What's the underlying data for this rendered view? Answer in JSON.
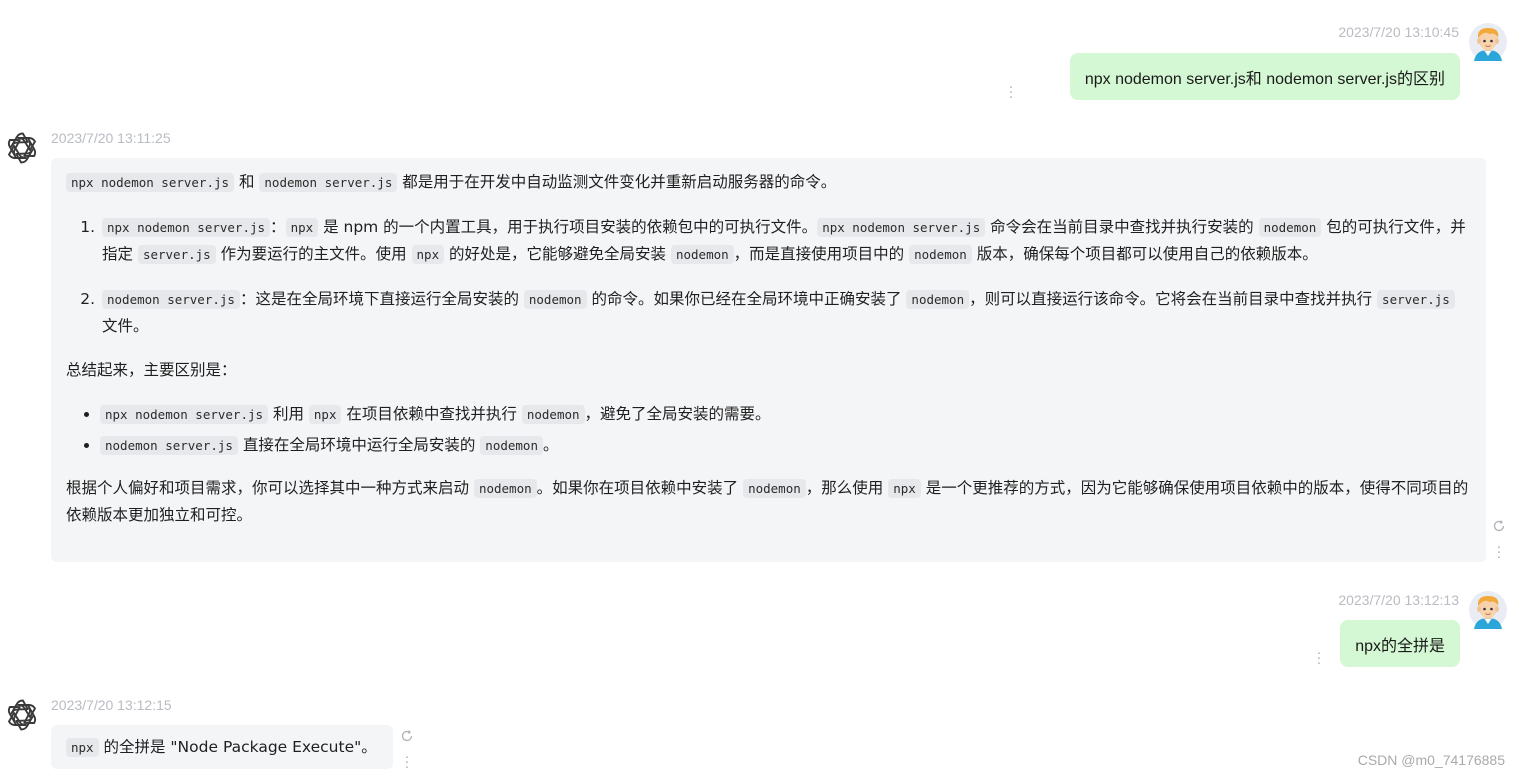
{
  "messages": [
    {
      "role": "user",
      "timestamp": "2023/7/20 13:10:45",
      "text": "npx nodemon server.js和 nodemon server.js的区别"
    },
    {
      "role": "assistant",
      "timestamp": "2023/7/20 13:11:25",
      "intro": {
        "code1": "npx nodemon server.js",
        "t1": " 和 ",
        "code2": "nodemon server.js",
        "t2": " 都是用于在开发中自动监测文件变化并重新启动服务器的命令。"
      },
      "item1": {
        "c1": "npx nodemon server.js",
        "t1": "：",
        "c2": "npx",
        "t2": " 是 npm 的一个内置工具，用于执行项目安装的依赖包中的可执行文件。",
        "c3": "npx nodemon server.js",
        "t3": " 命令会在当前目录中查找并执行安装的 ",
        "c4": "nodemon",
        "t4": " 包的可执行文件，并指定 ",
        "c5": "server.js",
        "t5": " 作为要运行的主文件。使用 ",
        "c6": "npx",
        "t6": " 的好处是，它能够避免全局安装 ",
        "c7": "nodemon",
        "t7": "，而是直接使用项目中的 ",
        "c8": "nodemon",
        "t8": " 版本，确保每个项目都可以使用自己的依赖版本。"
      },
      "item2": {
        "c1": "nodemon server.js",
        "t1": "：这是在全局环境下直接运行全局安装的 ",
        "c2": "nodemon",
        "t2": " 的命令。如果你已经在全局环境中正确安装了 ",
        "c3": "nodemon",
        "t3": "，则可以直接运行该命令。它将会在当前目录中查找并执行 ",
        "c4": "server.js",
        "t4": " 文件。"
      },
      "summary": "总结起来，主要区别是：",
      "bullet1": {
        "c1": "npx nodemon server.js",
        "t1": " 利用 ",
        "c2": "npx",
        "t2": " 在项目依赖中查找并执行 ",
        "c3": "nodemon",
        "t3": "，避免了全局安装的需要。"
      },
      "bullet2": {
        "c1": "nodemon server.js",
        "t1": " 直接在全局环境中运行全局安装的 ",
        "c2": "nodemon",
        "t2": "。"
      },
      "conclusion": {
        "t1": "根据个人偏好和项目需求，你可以选择其中一种方式来启动 ",
        "c1": "nodemon",
        "t2": "。如果你在项目依赖中安装了 ",
        "c2": "nodemon",
        "t3": "，那么使用 ",
        "c3": "npx",
        "t4": " 是一个更推荐的方式，因为它能够确保使用项目依赖中的版本，使得不同项目的依赖版本更加独立和可控。"
      }
    },
    {
      "role": "user",
      "timestamp": "2023/7/20 13:12:13",
      "text": "npx的全拼是"
    },
    {
      "role": "assistant",
      "timestamp": "2023/7/20 13:12:15",
      "code": "npx",
      "text": " 的全拼是 \"Node Package Execute\"。"
    }
  ],
  "watermark": "CSDN @m0_74176885",
  "icons": {
    "user_avatar": "cartoon-boy-avatar",
    "assistant_avatar": "openai-logo-icon",
    "more": "vertical-dots-icon",
    "regenerate": "refresh-icon"
  },
  "colors": {
    "user_bubble": "#d4f7d4",
    "assistant_bubble": "#f4f5f7",
    "timestamp": "#b9bcc2",
    "code_bg": "#e7e8eb"
  }
}
